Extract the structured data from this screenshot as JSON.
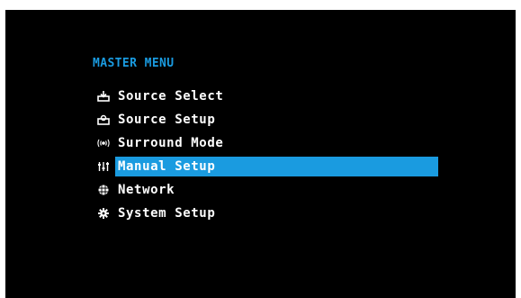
{
  "menu": {
    "title": "MASTER MENU",
    "items": [
      {
        "label": "Source Select",
        "icon": "source-select-icon"
      },
      {
        "label": "Source Setup",
        "icon": "source-setup-icon"
      },
      {
        "label": "Surround Mode",
        "icon": "surround-mode-icon"
      },
      {
        "label": "Manual Setup",
        "icon": "manual-setup-icon",
        "selected": true
      },
      {
        "label": "Network",
        "icon": "network-icon"
      },
      {
        "label": "System Setup",
        "icon": "system-setup-icon"
      }
    ]
  },
  "colors": {
    "accent": "#1a9be0",
    "background": "#000000",
    "text": "#ffffff"
  }
}
